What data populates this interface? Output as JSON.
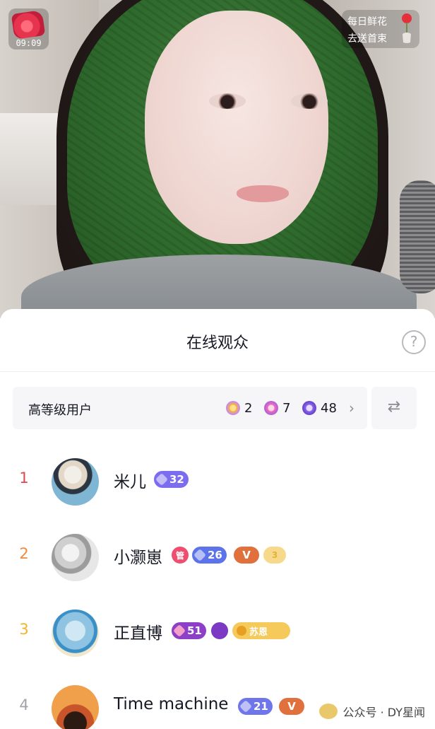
{
  "live": {
    "timer": "09:09",
    "flower_line1": "每日鲜花",
    "flower_line2": "去送首束"
  },
  "sheet": {
    "title": "在线观众",
    "help_glyph": "?",
    "level_bar": {
      "label": "高等级用户",
      "stats": [
        {
          "icon": "crown-gem-icon",
          "count": "2",
          "color": "#f4b43a"
        },
        {
          "icon": "pink-gem-icon",
          "count": "7",
          "color": "#ec6fae"
        },
        {
          "icon": "purple-gem-icon",
          "count": "48",
          "color": "#8b63e8"
        }
      ],
      "chevron": "›"
    },
    "swap_glyph": "⇄"
  },
  "viewers": [
    {
      "rank": "1",
      "rank_color": "#e0484f",
      "name": "米儿",
      "level": "32",
      "level_color": "#7c6cf0"
    },
    {
      "rank": "2",
      "rank_color": "#ef8a3e",
      "name": "小灏崽",
      "admin": "管",
      "level": "26",
      "level_color": "#5d73ea",
      "fan_badge": "V",
      "extra": "3"
    },
    {
      "rank": "3",
      "rank_color": "#f1b52c",
      "name": "正直博",
      "level": "51",
      "level_color": "#8d3fc7",
      "club_name": "苏恩"
    },
    {
      "rank": "4",
      "rank_color": "#a3a3a9",
      "name": "Time machine",
      "level": "21",
      "level_color": "#6f76ea",
      "fan_badge": "V"
    }
  ],
  "watermark": "公众号 · DY星闻",
  "colors": {
    "accent_red": "#e0484f",
    "sheet_bg": "#ffffff",
    "bar_bg": "#f6f6f8"
  }
}
